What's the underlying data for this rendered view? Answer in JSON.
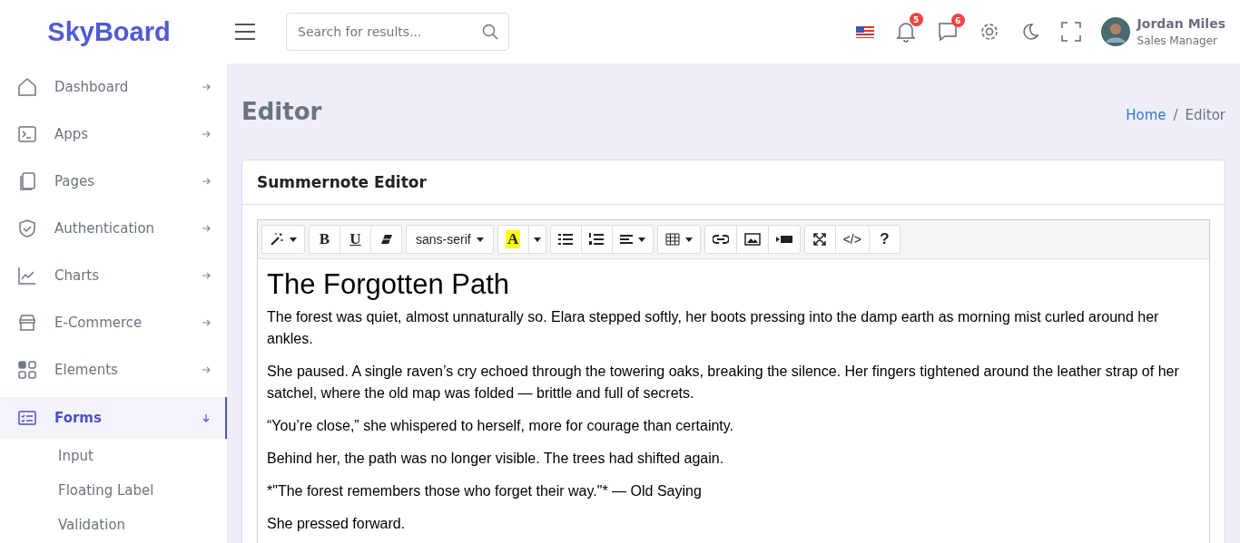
{
  "brand": "SkyBoard",
  "search": {
    "placeholder": "Search for results..."
  },
  "header": {
    "notifications": "5",
    "messages": "6",
    "user": {
      "name": "Jordan Miles",
      "role": "Sales Manager"
    }
  },
  "sidebar": {
    "items": [
      {
        "label": "Dashboard",
        "selected": false,
        "expanded": false
      },
      {
        "label": "Apps",
        "selected": false,
        "expanded": false
      },
      {
        "label": "Pages",
        "selected": false,
        "expanded": false
      },
      {
        "label": "Authentication",
        "selected": false,
        "expanded": false
      },
      {
        "label": "Charts",
        "selected": false,
        "expanded": false
      },
      {
        "label": "E-Commerce",
        "selected": false,
        "expanded": false
      },
      {
        "label": "Elements",
        "selected": false,
        "expanded": false
      },
      {
        "label": "Forms",
        "selected": true,
        "expanded": true,
        "children": [
          {
            "label": "Input"
          },
          {
            "label": "Floating Label"
          },
          {
            "label": "Validation"
          }
        ]
      }
    ]
  },
  "page": {
    "title": "Editor",
    "separator": "/",
    "breadcrumb": [
      {
        "label": "Home",
        "link": true
      },
      {
        "label": "Editor",
        "link": false
      }
    ]
  },
  "card": {
    "title": "Summernote Editor",
    "toolbar": [
      [
        {
          "kind": "magic",
          "dropdown": true
        }
      ],
      [
        {
          "kind": "bold",
          "label": "B"
        },
        {
          "kind": "underline",
          "label": "U"
        },
        {
          "kind": "eraser"
        }
      ],
      [
        {
          "kind": "text",
          "label": "sans-serif",
          "dropdown": true
        }
      ],
      [
        {
          "kind": "color",
          "label": "A"
        },
        {
          "kind": "caret"
        }
      ],
      [
        {
          "kind": "ul"
        },
        {
          "kind": "ol"
        },
        {
          "kind": "align",
          "dropdown": true
        }
      ],
      [
        {
          "kind": "table",
          "dropdown": true
        }
      ],
      [
        {
          "kind": "link"
        },
        {
          "kind": "picture"
        },
        {
          "kind": "video"
        }
      ],
      [
        {
          "kind": "fullscreen"
        },
        {
          "kind": "code",
          "label": "</>"
        },
        {
          "kind": "help",
          "label": "?"
        }
      ]
    ],
    "content": {
      "heading": "The Forgotten Path",
      "paragraphs": [
        "The forest was quiet, almost unnaturally so. Elara stepped softly, her boots pressing into the damp earth as morning mist curled around her ankles.",
        "She paused. A single raven’s cry echoed through the towering oaks, breaking the silence. Her fingers tightened around the leather strap of her satchel, where the old map was folded — brittle and full of secrets.",
        "“You’re close,” she whispered to herself, more for courage than certainty.",
        "Behind her, the path was no longer visible. The trees had shifted again.",
        "*\"The forest remembers those who forget their way.\"* — Old Saying",
        "She pressed forward."
      ]
    }
  }
}
